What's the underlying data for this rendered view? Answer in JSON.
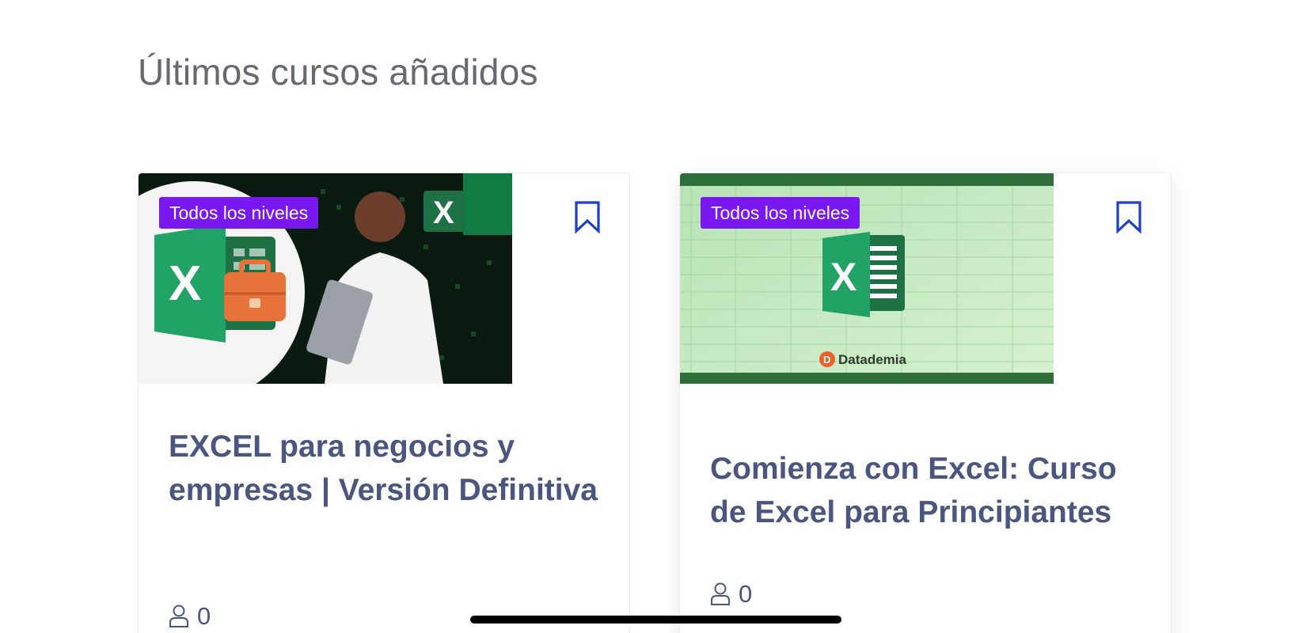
{
  "section": {
    "title": "Últimos cursos añadidos"
  },
  "courses": [
    {
      "level": "Todos los niveles",
      "title": "EXCEL para negocios y empresas | Versión Definitiva",
      "students": "0",
      "bookmark_icon": "bookmark-outline-icon",
      "student_icon": "user-outline-icon"
    },
    {
      "level": "Todos los niveles",
      "title": "Comienza con Excel: Curso de Excel para Principiantes",
      "students": "0",
      "bookmark_icon": "bookmark-outline-icon",
      "student_icon": "user-outline-icon",
      "thumbnail_brand": "Datademia"
    }
  ],
  "colors": {
    "badge": "#7a18f2",
    "title": "#4a5680",
    "bookmark": "#1f3fc4",
    "excel_green": "#1e7145"
  }
}
